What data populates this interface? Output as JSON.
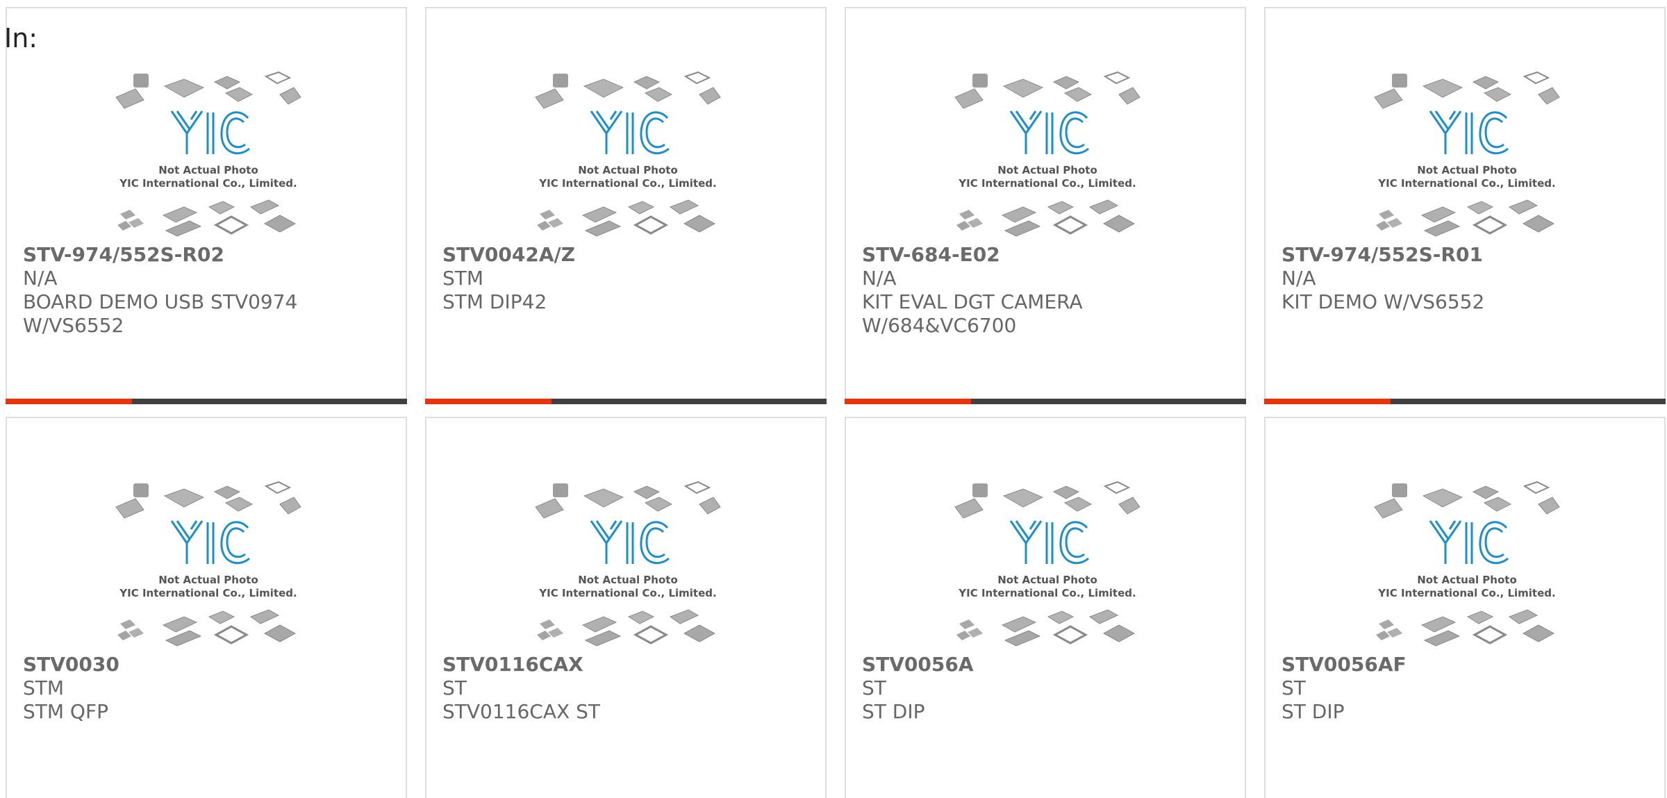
{
  "header": {
    "prefix": "In:"
  },
  "image_placeholder": {
    "line1": "Not Actual Photo",
    "line2": "YIC International Co., Limited.",
    "logo_text": "YIC"
  },
  "colors": {
    "accent": "#e8330d",
    "bar": "#404040",
    "logo_blue": "#1a8fd0",
    "chip_gray": "#a8a8a8"
  },
  "products": [
    {
      "part_no": "STV-974/552S-R02",
      "maker": "N/A",
      "desc": "BOARD DEMO USB STV0974 W/VS6552"
    },
    {
      "part_no": "STV0042A/Z",
      "maker": "STM",
      "desc": "STM DIP42"
    },
    {
      "part_no": "STV-684-E02",
      "maker": "N/A",
      "desc": "KIT EVAL DGT CAMERA W/684&VC6700"
    },
    {
      "part_no": "STV-974/552S-R01",
      "maker": "N/A",
      "desc": "KIT DEMO W/VS6552"
    },
    {
      "part_no": "STV0030",
      "maker": "STM",
      "desc": "STM QFP"
    },
    {
      "part_no": "STV0116CAX",
      "maker": "ST",
      "desc": "STV0116CAX ST"
    },
    {
      "part_no": "STV0056A",
      "maker": "ST",
      "desc": "ST DIP"
    },
    {
      "part_no": "STV0056AF",
      "maker": "ST",
      "desc": "ST DIP"
    }
  ]
}
